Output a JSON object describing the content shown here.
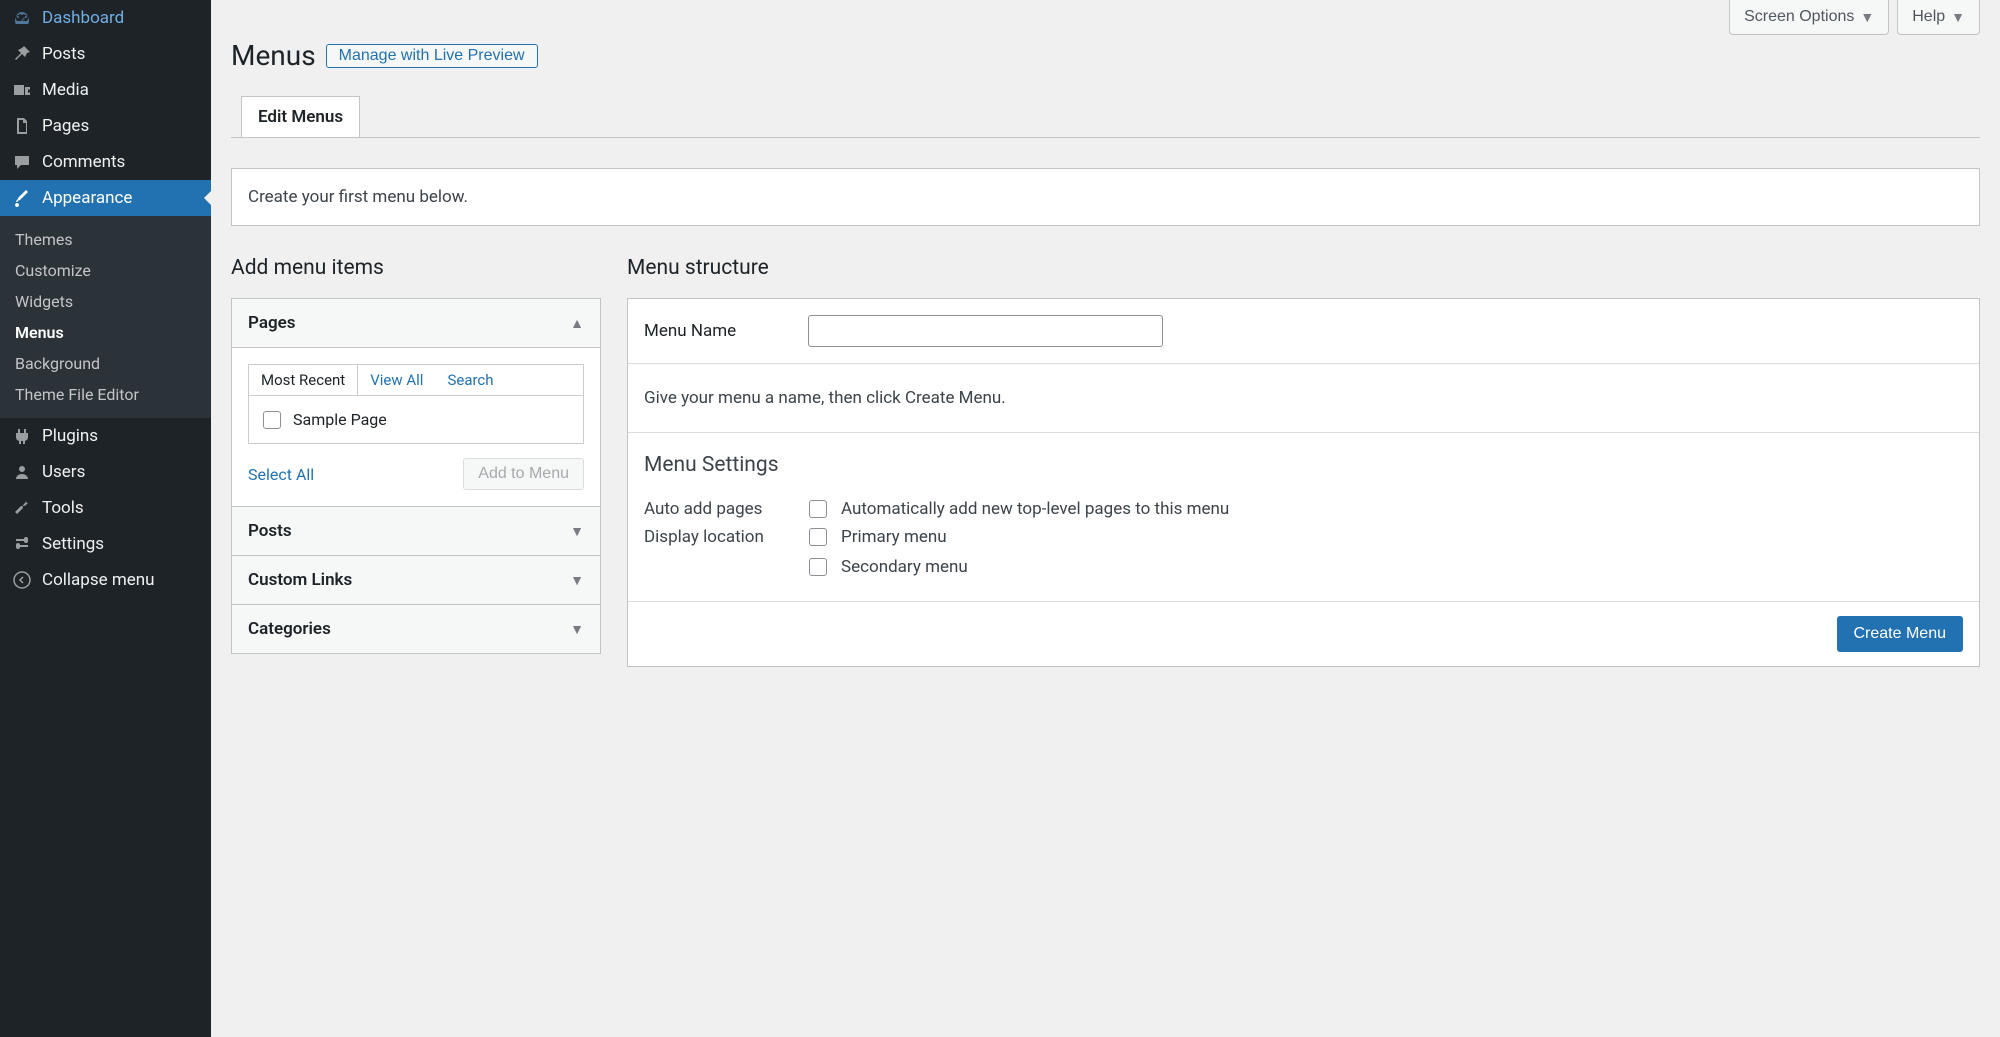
{
  "sidebar": {
    "items": [
      {
        "label": "Dashboard",
        "icon": "dashboard"
      },
      {
        "label": "Posts",
        "icon": "pin"
      },
      {
        "label": "Media",
        "icon": "media"
      },
      {
        "label": "Pages",
        "icon": "page"
      },
      {
        "label": "Comments",
        "icon": "comment"
      },
      {
        "label": "Appearance",
        "icon": "brush"
      },
      {
        "label": "Plugins",
        "icon": "plugin"
      },
      {
        "label": "Users",
        "icon": "user"
      },
      {
        "label": "Tools",
        "icon": "tool"
      },
      {
        "label": "Settings",
        "icon": "settings"
      }
    ],
    "submenu": [
      {
        "label": "Themes"
      },
      {
        "label": "Customize"
      },
      {
        "label": "Widgets"
      },
      {
        "label": "Menus"
      },
      {
        "label": "Background"
      },
      {
        "label": "Theme File Editor"
      }
    ],
    "collapse": "Collapse menu"
  },
  "topbar": {
    "screen_options": "Screen Options",
    "help": "Help"
  },
  "header": {
    "title": "Menus",
    "manage_btn": "Manage with Live Preview"
  },
  "tabs": {
    "edit": "Edit Menus"
  },
  "notice": "Create your first menu below.",
  "left": {
    "title": "Add menu items",
    "boxes": [
      {
        "title": "Pages",
        "open": true
      },
      {
        "title": "Posts",
        "open": false
      },
      {
        "title": "Custom Links",
        "open": false
      },
      {
        "title": "Categories",
        "open": false
      }
    ],
    "inner_tabs": [
      "Most Recent",
      "View All",
      "Search"
    ],
    "page_item": "Sample Page",
    "select_all": "Select All",
    "add_to_menu": "Add to Menu"
  },
  "right": {
    "title": "Menu structure",
    "menu_name_label": "Menu Name",
    "menu_name_value": "",
    "instruction": "Give your menu a name, then click Create Menu.",
    "settings_title": "Menu Settings",
    "auto_add_label": "Auto add pages",
    "auto_add_opt": "Automatically add new top-level pages to this menu",
    "display_loc_label": "Display location",
    "loc_primary": "Primary menu",
    "loc_secondary": "Secondary menu",
    "create_btn": "Create Menu"
  }
}
